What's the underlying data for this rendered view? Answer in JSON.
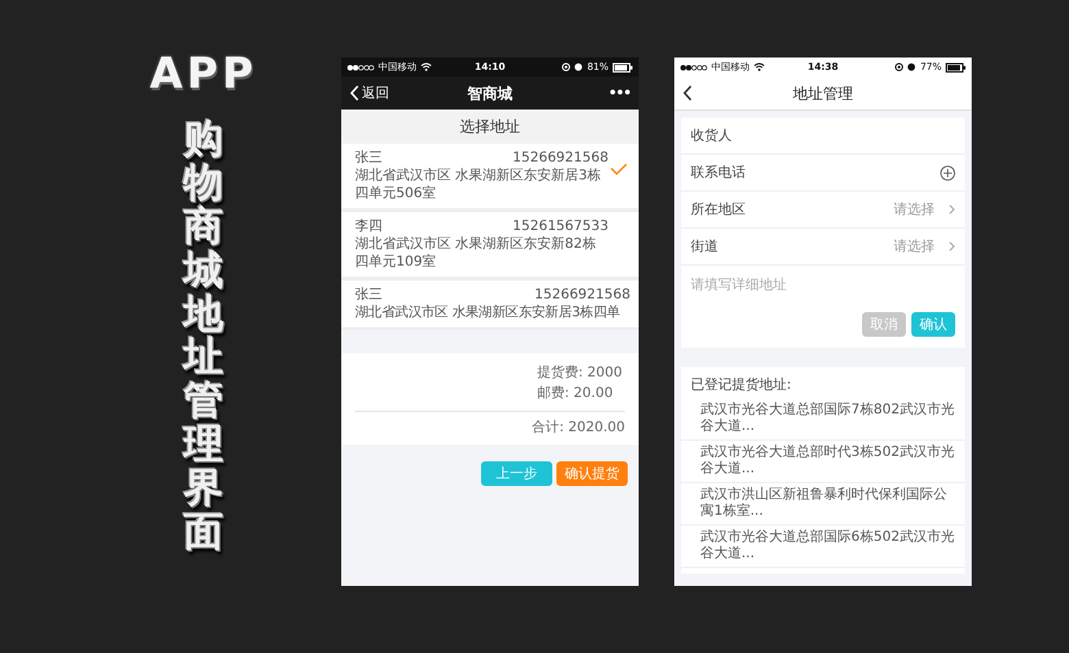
{
  "poster": {
    "heading": "APP",
    "vertical_title": "购物商城地址管理界面"
  },
  "select_screen": {
    "status_bar": {
      "carrier": "中国移动",
      "time": "14:10",
      "battery": "81%"
    },
    "nav": {
      "back": "返回",
      "title": "智商城",
      "more": "•••"
    },
    "header": "选择地址",
    "addresses": [
      {
        "name": "张三",
        "phone": "15266921568",
        "address": "湖北省武汉市区 水果湖新区东安新居3栋四单元506室",
        "selected": true
      },
      {
        "name": "李四",
        "phone": "15261567533",
        "address": "湖北省武汉市区 水果湖新区东安新82栋四单元109室",
        "selected": false
      },
      {
        "name": "张三",
        "phone": "15266921568",
        "address": "湖北省武汉市区 水果湖新区东安新居3栋四单",
        "selected": false
      }
    ],
    "fees": [
      {
        "kind": "line",
        "text": "提货费: 2000"
      },
      {
        "kind": "line",
        "text": "邮费: 20.00"
      },
      {
        "kind": "total",
        "text": "合计: 2020.00"
      }
    ],
    "buttons": [
      {
        "kind": "secondary",
        "label": "上一步"
      },
      {
        "kind": "primary",
        "label": "确认提货"
      }
    ]
  },
  "form_screen": {
    "status_bar": {
      "carrier": "中国移动",
      "time": "14:38",
      "battery": "77%"
    },
    "nav": {
      "title": "地址管理"
    },
    "fields": [
      {
        "kind": "input",
        "label": "收货人"
      },
      {
        "kind": "contact",
        "label": "联系电话"
      },
      {
        "kind": "picker",
        "label": "所在地区",
        "placeholder": "请选择"
      },
      {
        "kind": "picker",
        "label": "街道",
        "placeholder": "请选择"
      }
    ],
    "detail": {
      "placeholder": "请填写详细地址"
    },
    "buttons": [
      {
        "kind": "cancel",
        "label": "取消"
      },
      {
        "kind": "confirm",
        "label": "确认"
      }
    ],
    "saved": {
      "heading": "已登记提货地址:",
      "items": [
        "武汉市光谷大道总部国际7栋802武汉市光谷大道...",
        "武汉市光谷大道总部时代3栋502武汉市光谷大道...",
        "武汉市洪山区新祖鲁暴利时代保利国际公寓1栋室...",
        "武汉市光谷大道总部国际6栋502武汉市光谷大道..."
      ]
    }
  }
}
